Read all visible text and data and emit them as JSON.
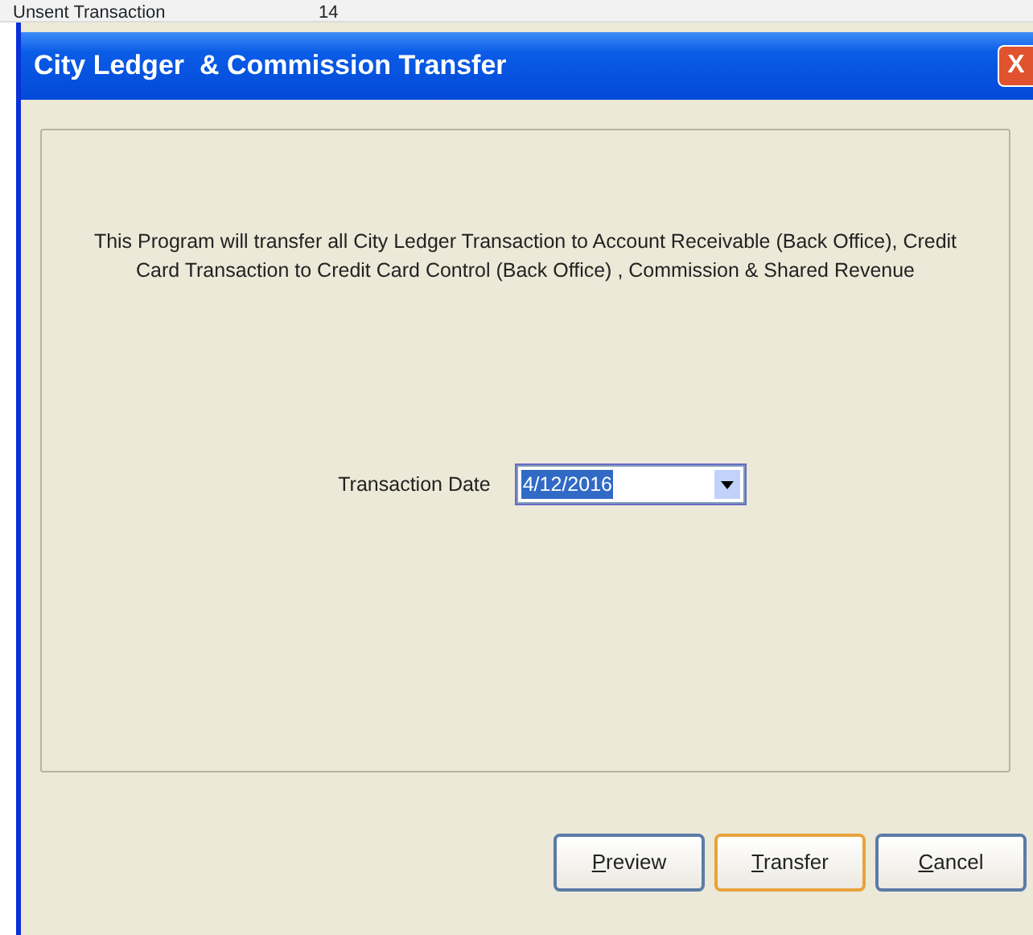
{
  "background": {
    "row_label": "Unsent Transaction",
    "row_value": "14"
  },
  "window": {
    "title": "City Ledger  & Commission Transfer",
    "close": "X"
  },
  "message": "This Program will transfer all City Ledger Transaction to Account Receivable (Back Office), Credit Card Transaction to Credit Card Control (Back Office) , Commission & Shared Revenue",
  "date_field": {
    "label": "Transaction Date",
    "value": "4/12/2016",
    "text_selected": true
  },
  "buttons": [
    {
      "key": "P",
      "rest": "review",
      "default": false
    },
    {
      "key": "T",
      "rest": "ransfer",
      "default": true
    },
    {
      "key": "C",
      "rest": "ancel",
      "default": false
    }
  ]
}
